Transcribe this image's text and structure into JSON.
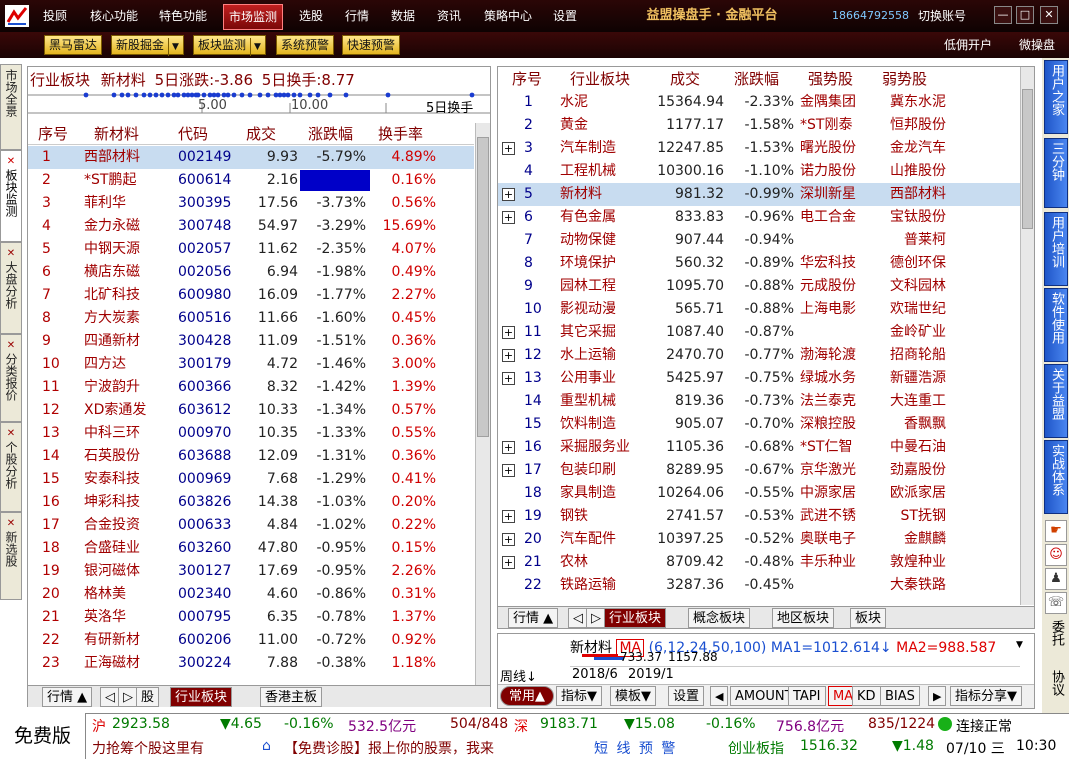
{
  "topbar": {
    "menus": [
      "投顾",
      "核心功能",
      "特色功能",
      "市场监测",
      "选股",
      "行情",
      "数据",
      "资讯",
      "策略中心",
      "设置"
    ],
    "active_menu": "市场监测",
    "brand": "益盟操盘手 · 金融平台",
    "phone": "18664792558",
    "switch_account": "切换账号",
    "win_min": "—",
    "win_max": "□",
    "win_close": "✕"
  },
  "toolbar2": {
    "buttons": [
      "黑马雷达",
      "新股掘金",
      "板块监测",
      "系统预警",
      "快速预警"
    ],
    "right_links": [
      "低佣开户",
      "微操盘"
    ]
  },
  "left_tabs": [
    "市场全景",
    "板块监测",
    "大盘分析",
    "分类报价",
    "个股分析",
    "新选股"
  ],
  "header": {
    "label": "行业板块",
    "sector": "新材料",
    "five_day_change": "5日涨跌:-3.86",
    "five_day_turnover": "5日换手:8.77",
    "axis_ticks": [
      "5.00",
      "10.00"
    ],
    "axis_label": "5日换手"
  },
  "stock_table": {
    "columns": [
      "序号",
      "新材料",
      "代码",
      "成交",
      "涨跌幅",
      "换手率"
    ],
    "rows": [
      [
        "1",
        "西部材料",
        "002149",
        "9.93",
        "-5.79%",
        "4.89%"
      ],
      [
        "2",
        "*ST鹏起",
        "600614",
        "2.16",
        "",
        "0.16%"
      ],
      [
        "3",
        "菲利华",
        "300395",
        "17.56",
        "-3.73%",
        "0.56%"
      ],
      [
        "4",
        "金力永磁",
        "300748",
        "54.97",
        "-3.29%",
        "15.69%"
      ],
      [
        "5",
        "中钢天源",
        "002057",
        "11.62",
        "-2.35%",
        "4.07%"
      ],
      [
        "6",
        "横店东磁",
        "002056",
        "6.94",
        "-1.98%",
        "0.49%"
      ],
      [
        "7",
        "北矿科技",
        "600980",
        "16.09",
        "-1.77%",
        "2.27%"
      ],
      [
        "8",
        "方大炭素",
        "600516",
        "11.66",
        "-1.60%",
        "0.45%"
      ],
      [
        "9",
        "四通新材",
        "300428",
        "11.09",
        "-1.51%",
        "0.36%"
      ],
      [
        "10",
        "四方达",
        "300179",
        "4.72",
        "-1.46%",
        "3.00%"
      ],
      [
        "11",
        "宁波韵升",
        "600366",
        "8.32",
        "-1.42%",
        "1.39%"
      ],
      [
        "12",
        "XD索通发",
        "603612",
        "10.33",
        "-1.34%",
        "0.57%"
      ],
      [
        "13",
        "中科三环",
        "000970",
        "10.35",
        "-1.33%",
        "0.55%"
      ],
      [
        "14",
        "石英股份",
        "603688",
        "12.09",
        "-1.31%",
        "0.36%"
      ],
      [
        "15",
        "安泰科技",
        "000969",
        "7.68",
        "-1.29%",
        "0.41%"
      ],
      [
        "16",
        "坤彩科技",
        "603826",
        "14.38",
        "-1.03%",
        "0.20%"
      ],
      [
        "17",
        "合金投资",
        "000633",
        "4.84",
        "-1.02%",
        "0.22%"
      ],
      [
        "18",
        "合盛硅业",
        "603260",
        "47.80",
        "-0.95%",
        "0.15%"
      ],
      [
        "19",
        "银河磁体",
        "300127",
        "17.69",
        "-0.95%",
        "2.26%"
      ],
      [
        "20",
        "格林美",
        "002340",
        "4.60",
        "-0.86%",
        "0.31%"
      ],
      [
        "21",
        "英洛华",
        "000795",
        "6.35",
        "-0.78%",
        "1.37%"
      ],
      [
        "22",
        "有研新材",
        "600206",
        "11.00",
        "-0.72%",
        "0.92%"
      ],
      [
        "23",
        "正海磁材",
        "300224",
        "7.88",
        "-0.38%",
        "1.18%"
      ]
    ]
  },
  "left_bottom_tabs": [
    "行情",
    "股",
    "行业板块",
    "香港主板"
  ],
  "sector_table": {
    "columns": [
      "序号",
      "行业板块",
      "成交",
      "涨跌幅",
      "强势股",
      "弱势股"
    ],
    "rows": [
      [
        "1",
        "水泥",
        "15364.94",
        "-2.33%",
        "金隅集团",
        "冀东水泥"
      ],
      [
        "2",
        "黄金",
        "1177.17",
        "-1.58%",
        "*ST刚泰",
        "恒邦股份"
      ],
      [
        "3",
        "汽车制造",
        "12247.85",
        "-1.53%",
        "曙光股份",
        "金龙汽车"
      ],
      [
        "4",
        "工程机械",
        "10300.16",
        "-1.10%",
        "诺力股份",
        "山推股份"
      ],
      [
        "5",
        "新材料",
        "981.32",
        "-0.99%",
        "深圳新星",
        "西部材料"
      ],
      [
        "6",
        "有色金属",
        "833.83",
        "-0.96%",
        "电工合金",
        "宝钛股份"
      ],
      [
        "7",
        "动物保健",
        "907.44",
        "-0.94%",
        "",
        "普莱柯"
      ],
      [
        "8",
        "环境保护",
        "560.32",
        "-0.89%",
        "华宏科技",
        "德创环保"
      ],
      [
        "9",
        "园林工程",
        "1095.70",
        "-0.88%",
        "元成股份",
        "文科园林"
      ],
      [
        "10",
        "影视动漫",
        "565.71",
        "-0.88%",
        "上海电影",
        "欢瑞世纪"
      ],
      [
        "11",
        "其它采掘",
        "1087.40",
        "-0.87%",
        "",
        "金岭矿业"
      ],
      [
        "12",
        "水上运输",
        "2470.70",
        "-0.77%",
        "渤海轮渡",
        "招商轮船"
      ],
      [
        "13",
        "公用事业",
        "5425.97",
        "-0.75%",
        "绿城水务",
        "新疆浩源"
      ],
      [
        "14",
        "重型机械",
        "819.36",
        "-0.73%",
        "法兰泰克",
        "大连重工"
      ],
      [
        "15",
        "饮料制造",
        "905.07",
        "-0.70%",
        "深粮控股",
        "香飘飘"
      ],
      [
        "16",
        "采掘服务业",
        "1105.36",
        "-0.68%",
        "*ST仁智",
        "中曼石油"
      ],
      [
        "17",
        "包装印刷",
        "8289.95",
        "-0.67%",
        "京华激光",
        "劲嘉股份"
      ],
      [
        "18",
        "家具制造",
        "10264.06",
        "-0.55%",
        "中源家居",
        "欧派家居"
      ],
      [
        "19",
        "钢铁",
        "2741.57",
        "-0.53%",
        "武进不锈",
        "ST抚钢"
      ],
      [
        "20",
        "汽车配件",
        "10397.25",
        "-0.52%",
        "奥联电子",
        "金麒麟"
      ],
      [
        "21",
        "农林",
        "8709.42",
        "-0.48%",
        "丰乐种业",
        "敦煌种业"
      ],
      [
        "22",
        "铁路运输",
        "3287.36",
        "-0.45%",
        "",
        "大秦铁路"
      ]
    ],
    "plus_rows": [
      3,
      5,
      6,
      11,
      12,
      13,
      16,
      17,
      19,
      20,
      21
    ]
  },
  "right_bottom_tabs": [
    "行情",
    "行业板块",
    "概念板块",
    "地区板块",
    "板块"
  ],
  "mini_chart": {
    "sector": "新材料",
    "ma_tag": "MA",
    "ma_params": "(6,12,24,50,100)",
    "ma1": "MA1=1012.614",
    "ma2": "MA2=988.587",
    "values": "733.37",
    "value2": "1157.88",
    "period": "周线",
    "dates": [
      "2018/6",
      "2019/1"
    ],
    "tools": [
      "常用",
      "指标",
      "模板",
      "设置",
      "AMOUNT",
      "TAPI",
      "MA",
      "KD",
      "BIAS",
      "指标分享"
    ]
  },
  "right_sidebar": {
    "tabs": [
      "用户之家",
      "三分钟",
      "用户培训",
      "软件使用",
      "关于益盟",
      "实战体系"
    ],
    "bottom": [
      "委托",
      "协议"
    ]
  },
  "status": {
    "free": "免费版",
    "sh_name": "沪",
    "sh_index": "2923.58",
    "sh_change": "▼4.65",
    "sh_pct": "-0.16%",
    "sh_amount": "532.5亿元",
    "sh_updown": "504/848",
    "sz_name": "深",
    "sz_index": "9183.71",
    "sz_change": "▼15.08",
    "sz_pct": "-0.16%",
    "sz_amount": "756.8亿元",
    "sz_updown": "835/1224",
    "connection": "连接正常",
    "news": "力抢筹个股这里有",
    "promo": "【免费诊股】报上你的股票，我来",
    "alert": "短 线 预 警",
    "gem_name": "创业板指",
    "gem_index": "1516.32",
    "gem_change": "▼1.48",
    "date": "07/10 三",
    "time": "10:30"
  },
  "colors": {
    "accent": "#800000",
    "blue_tab": "#2f6be0",
    "up": "#d00000",
    "down": "#007a00"
  }
}
